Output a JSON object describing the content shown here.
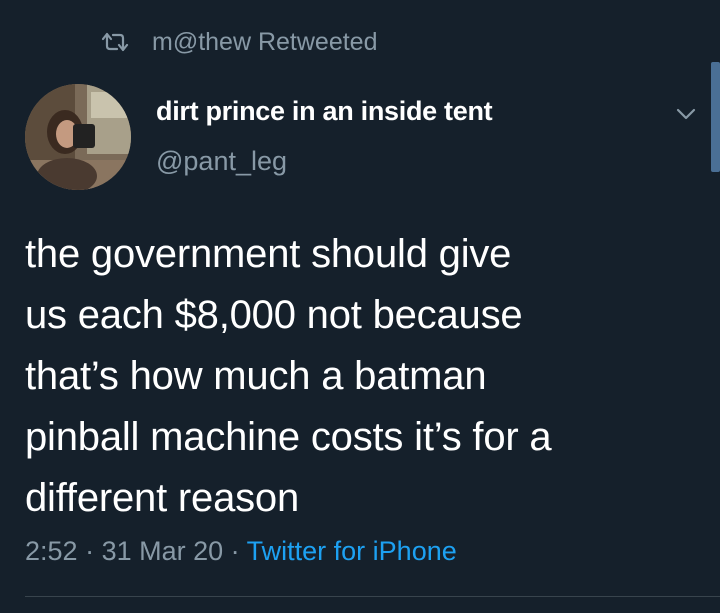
{
  "retweet": {
    "icon": "retweet-icon",
    "text": "m@thew Retweeted"
  },
  "author": {
    "avatar": "avatar",
    "name": "dirt prince in an inside tent",
    "handle": "@pant_leg"
  },
  "menu": {
    "icon": "chevron-down-icon"
  },
  "tweet": {
    "text": "the government should give\nus each $8,000 not because\nthat’s how much a batman\npinball machine costs it’s for a\ndifferent reason"
  },
  "meta": {
    "time": "2:52",
    "separator_1": " · ",
    "date": "31 Mar 20",
    "separator_2": " · ",
    "source": "Twitter for iPhone"
  },
  "colors": {
    "background": "#15202b",
    "text": "#ffffff",
    "secondary_text": "#8899a6",
    "link": "#1da1f2",
    "divider": "#38444d"
  }
}
